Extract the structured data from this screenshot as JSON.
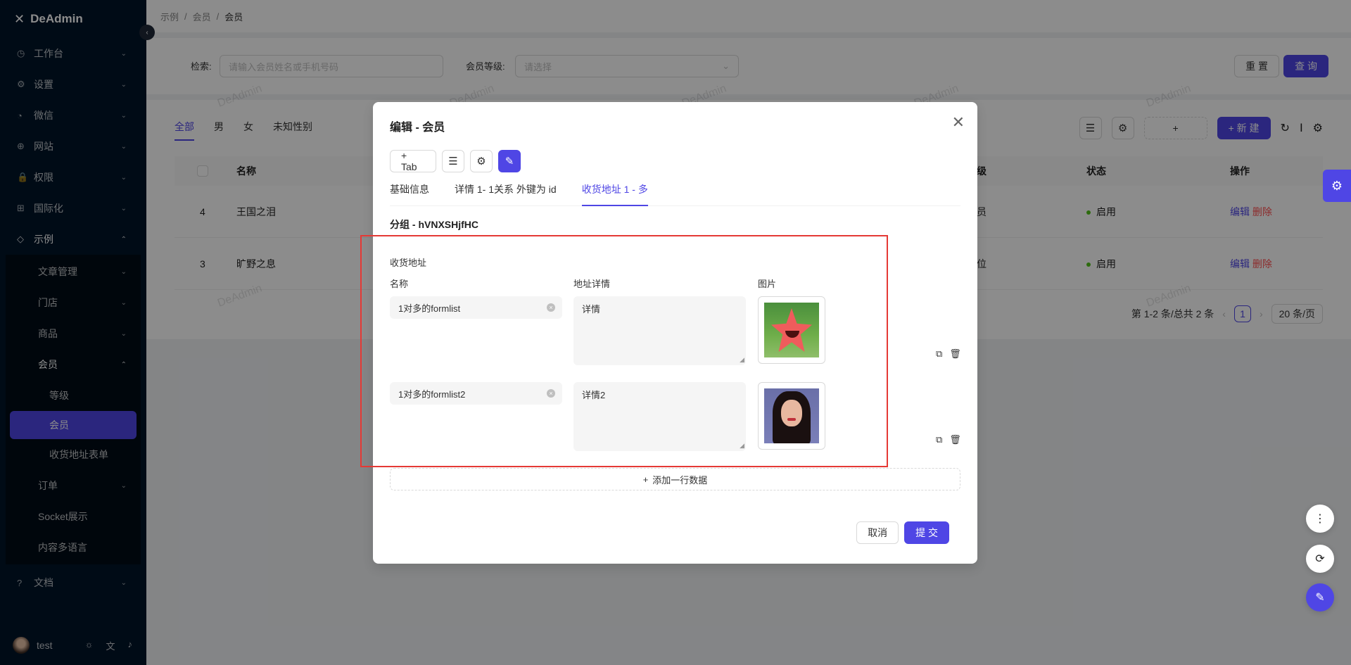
{
  "app": {
    "logo": "DeAdmin",
    "user": "test"
  },
  "sidebar": {
    "items": [
      {
        "icon": "◷",
        "label": "工作台"
      },
      {
        "icon": "⚙",
        "label": "设置"
      },
      {
        "icon": "◔",
        "label": "微信"
      },
      {
        "icon": "⊕",
        "label": "网站"
      },
      {
        "icon": "🔒",
        "label": "权限"
      },
      {
        "icon": "⊞",
        "label": "国际化"
      },
      {
        "icon": "◇",
        "label": "示例"
      }
    ],
    "sub": [
      {
        "label": "文章管理"
      },
      {
        "label": "门店"
      },
      {
        "label": "商品"
      },
      {
        "label": "会员"
      }
    ],
    "sub2": [
      {
        "label": "等级"
      },
      {
        "label": "会员"
      },
      {
        "label": "收货地址表单"
      }
    ],
    "sub3": [
      {
        "label": "订单"
      },
      {
        "label": "Socket展示"
      },
      {
        "label": "内容多语言"
      }
    ],
    "docs": {
      "icon": "?",
      "label": "文档"
    }
  },
  "breadcrumb": [
    "示例",
    "会员",
    "会员"
  ],
  "search": {
    "label1": "检索:",
    "placeholder1": "请输入会员姓名或手机号码",
    "label2": "会员等级:",
    "placeholder2": "请选择",
    "reset": "重 置",
    "query": "查 询"
  },
  "table": {
    "tabs": [
      "全部",
      "男",
      "女",
      "未知性别"
    ],
    "new_btn": "+ 新 建",
    "add_btn": "+",
    "headers": {
      "name": "名称",
      "level": "级",
      "status": "状态",
      "ops": "操作"
    },
    "rows": [
      {
        "id": "4",
        "name": "王国之泪",
        "level": "员",
        "status": "启用",
        "edit": "编辑",
        "delete": "删除"
      },
      {
        "id": "3",
        "name": "旷野之息",
        "level": "位",
        "status": "启用",
        "edit": "编辑",
        "delete": "删除"
      }
    ],
    "pager": {
      "summary": "第 1-2 条/总共 2 条",
      "page": "1",
      "size": "20 条/页"
    }
  },
  "watermark": "DeAdmin",
  "modal": {
    "title": "编辑 - 会员",
    "tab_btn": "+ Tab",
    "tabs": [
      "基础信息",
      "详情 1- 1关系 外键为 id",
      "收货地址 1 - 多"
    ],
    "group": "分组 - hVNXSHjfHC",
    "section": "收货地址",
    "cols": {
      "name": "名称",
      "detail": "地址详情",
      "image": "图片"
    },
    "rows": [
      {
        "name": "1对多的formlist",
        "detail": "详情"
      },
      {
        "name": "1对多的formlist2",
        "detail": "详情2"
      }
    ],
    "add_row": "添加一行数据",
    "cancel": "取消",
    "submit": "提 交"
  }
}
